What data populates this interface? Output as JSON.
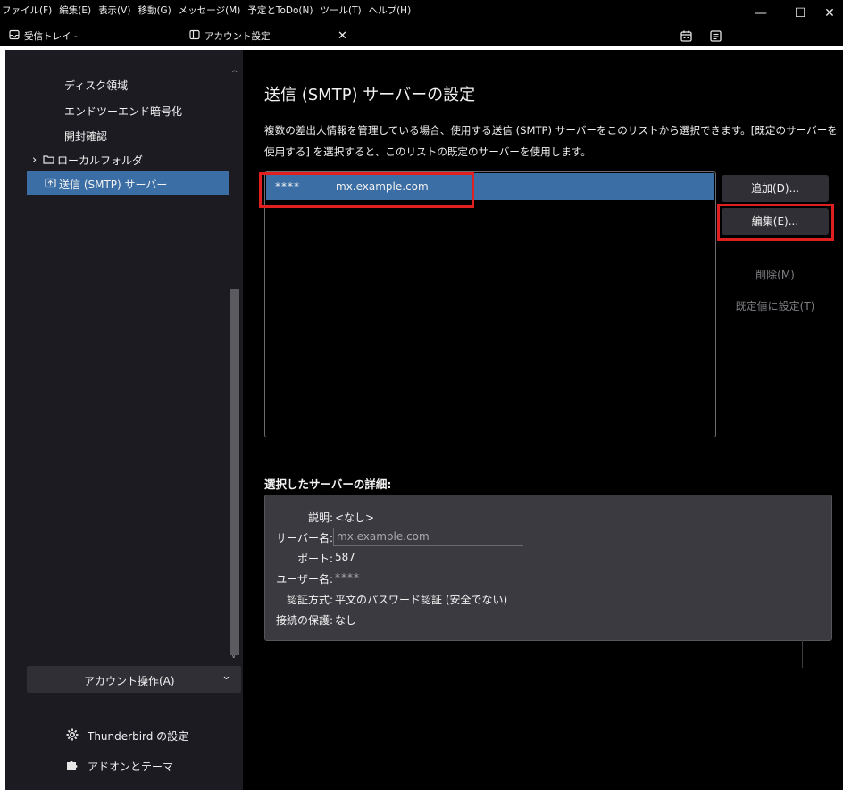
{
  "menu": [
    "ファイル(F)",
    "編集(E)",
    "表示(V)",
    "移動(G)",
    "メッセージ(M)",
    "予定とToDo(N)",
    "ツール(T)",
    "ヘルプ(H)"
  ],
  "window": {
    "minimize": "—",
    "maximize": "☐",
    "close": "✕"
  },
  "tabs": [
    {
      "label": "受信トレイ -",
      "icon": "inbox-icon"
    },
    {
      "label": "アカウント設定",
      "icon": "account-settings-icon",
      "close": "✕"
    }
  ],
  "sidebar": {
    "items": [
      {
        "label": "ディスク領域"
      },
      {
        "label": "エンドツーエンド暗号化"
      },
      {
        "label": "開封確認"
      },
      {
        "label": "ローカルフォルダ",
        "icon": "folder-icon",
        "expand": "›"
      },
      {
        "label": "送信 (SMTP) サーバー",
        "icon": "outgoing-server-icon"
      }
    ],
    "account_actions": "アカウント操作(A)",
    "account_actions_chevron": "⌄",
    "footer": [
      {
        "label": "Thunderbird の設定",
        "icon": "gear-icon"
      },
      {
        "label": "アドオンとテーマ",
        "icon": "puzzle-icon"
      }
    ]
  },
  "main": {
    "title": "送信 (SMTP) サーバーの設定",
    "description": "複数の差出人情報を管理している場合、使用する送信 (SMTP) サーバーをこのリストから選択できます。[既定のサーバーを使用する] を選択すると、このリストの既定のサーバーを使用します。",
    "servers": [
      {
        "name": "****",
        "separator": "-",
        "host": "mx.example.com"
      }
    ],
    "buttons": {
      "add": "追加(D)...",
      "edit": "編集(E)...",
      "delete": "削除(M)",
      "set_default": "既定値に設定(T)"
    },
    "details_heading": "選択したサーバーの詳細:",
    "details": {
      "description_label": "説明:",
      "description_value": "<なし>",
      "server_label": "サーバー名:",
      "server_value": "mx.example.com",
      "port_label": "ポート:",
      "port_value": "587",
      "user_label": "ユーザー名:",
      "user_value": "****",
      "auth_label": "認証方式:",
      "auth_value": "平文のパスワード認証 (安全でない)",
      "security_label": "接続の保護:",
      "security_value": "なし"
    }
  },
  "colors": {
    "selection": "#3b6ea5",
    "highlight_border": "#e02020",
    "sidebar_bg": "#1c1b22",
    "main_bg": "#000000"
  }
}
